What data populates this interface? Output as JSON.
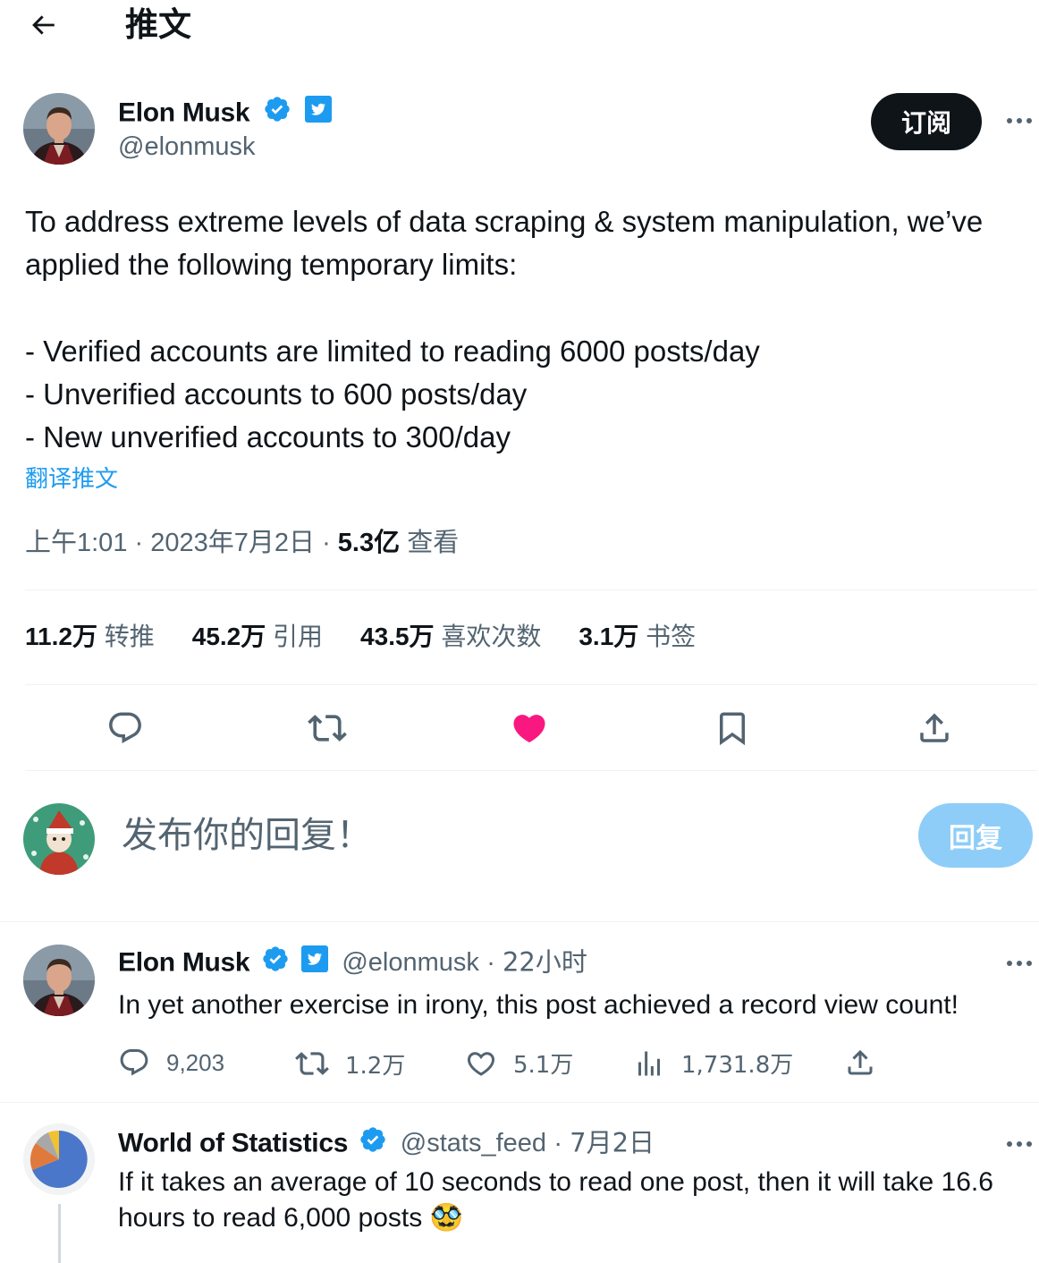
{
  "header": {
    "title": "推文"
  },
  "tweet": {
    "author": {
      "name": "Elon Musk",
      "handle": "@elonmusk"
    },
    "subscribe_label": "订阅",
    "text": "To address extreme levels of data scraping & system manipulation, we’ve applied the following temporary limits:\n\n- Verified accounts are limited to reading 6000 posts/day\n- Unverified accounts to 600 posts/day\n- New unverified accounts to 300/day",
    "translate_label": "翻译推文",
    "time": "上午1:01",
    "date": "2023年7月2日",
    "views_value": "5.3亿",
    "views_label": "查看",
    "stats": [
      {
        "value": "11.2万",
        "label": "转推"
      },
      {
        "value": "45.2万",
        "label": "引用"
      },
      {
        "value": "43.5万",
        "label": "喜欢次数"
      },
      {
        "value": "3.1万",
        "label": "书签"
      }
    ]
  },
  "compose": {
    "placeholder": "发布你的回复！",
    "button_label": "回复"
  },
  "replies": [
    {
      "name": "Elon Musk",
      "handle": "@elonmusk",
      "time": "22小时",
      "text": "In yet another exercise in irony, this post achieved a record view count!",
      "replies_count": "9,203",
      "retweets_count": "1.2万",
      "likes_count": "5.1万",
      "views_count": "1,731.8万"
    },
    {
      "name": "World of Statistics",
      "handle": "@stats_feed",
      "time": "7月2日",
      "text": "If it takes an average of 10 seconds to read one post, then it will take 16.6 hours to read 6,000 posts 🥸"
    }
  ],
  "colors": {
    "accent": "#1d9bf0",
    "like": "#f91880",
    "text": "#0f1419",
    "muted": "#536471",
    "border": "#eff3f4"
  }
}
